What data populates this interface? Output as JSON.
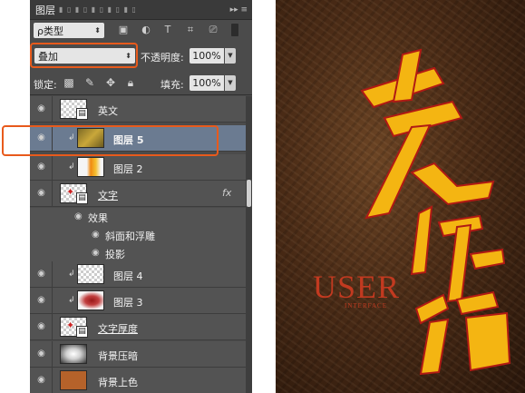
{
  "panel": {
    "tab_label": "图层",
    "filter": {
      "type_label": "ρ类型"
    },
    "blend": {
      "mode": "叠加",
      "opacity_label": "不透明度:",
      "opacity_value": "100%",
      "lock_label": "锁定:",
      "fill_label": "填充:",
      "fill_value": "100%"
    },
    "layers": [
      {
        "name": "英文"
      },
      {
        "name": "图层 5"
      },
      {
        "name": "图层 2"
      },
      {
        "name": "文字",
        "fx": "fx"
      },
      {
        "name": "效果"
      },
      {
        "name": "斜面和浮雕"
      },
      {
        "name": "投影"
      },
      {
        "name": "图层 4"
      },
      {
        "name": "图层 3"
      },
      {
        "name": "文字厚度"
      },
      {
        "name": "背景压暗"
      },
      {
        "name": "背景上色"
      }
    ]
  },
  "canvas": {
    "watermark_title": "USER",
    "watermark_sub": "INTERFACE"
  },
  "colors": {
    "highlight": "#e85a1c",
    "selected_layer": "#6b7b91",
    "gold": "#f4b512",
    "red_extrude": "#c8201b"
  }
}
